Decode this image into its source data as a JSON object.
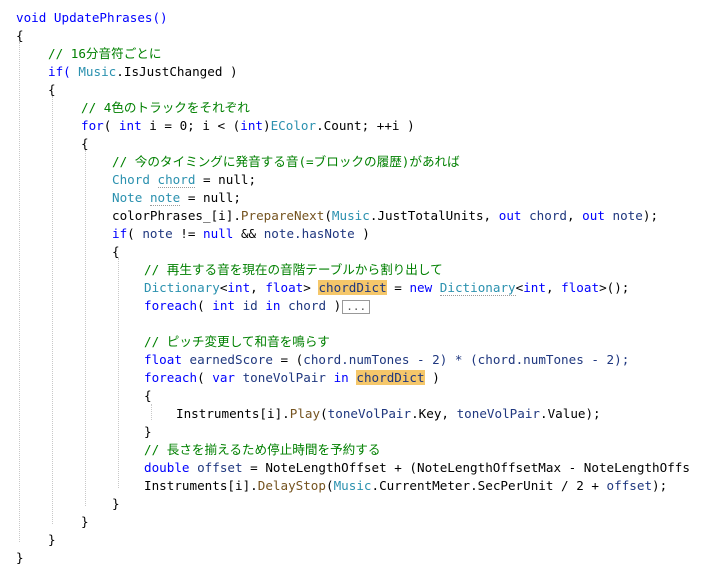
{
  "code": {
    "l01": "void UpdatePhrases()",
    "brace_open": "{",
    "brace_close": "}",
    "comment_16th": "// 16分音符ごとに",
    "if_music": "if( ",
    "music": "Music",
    "dot": ".",
    "is_just_changed": "IsJustChanged",
    "paren_close": " )",
    "comment_4color": "// 4色のトラックをそれぞれ",
    "for_kw": "for",
    "for_open": "( ",
    "int_kw": "int",
    "for_mid1": " i = 0; i < (",
    "for_mid2": ")",
    "ecolor": "EColor",
    "for_end": ".Count; ++i )",
    "comment_timing": "// 今のタイミングに発音する音(=ブロックの履歴)があれば",
    "chord_type": "Chord",
    "chord_var": "chord",
    "eq_null": " = null;",
    "null_kw": "null",
    "note_type": "Note",
    "note_var": "note",
    "color_phrases": "colorPhrases_[i].",
    "prepare_next": "PrepareNext",
    "just_total_units": ".JustTotalUnits, ",
    "out_kw": "out",
    "comma_space": ", ",
    "close_paren_semi": ");",
    "if_kw": "if",
    "neq_null": " != ",
    "and_and": " && ",
    "has_note": "note.hasNote",
    "comment_replay": "// 再生する音を現在の音階テーブルから割り出して",
    "dictionary": "Dictionary",
    "lt": "<",
    "float_kw": "float",
    "gt": ">",
    "chord_dict": "chordDict",
    "eq_new": " = ",
    "new_kw": "new",
    "gt_call": ">();",
    "foreach_kw": "foreach",
    "id_var": " id ",
    "in_kw": "in",
    "fold_ellipsis": "...",
    "comment_pitch": "// ピッチ変更して和音を鳴らす",
    "earned_score": "earnedScore",
    "num_tones_a": "chord.numTones - 2) * (",
    "num_tones_b": "chord.numTones - 2);",
    "var_kw": "var",
    "tone_vol_pair": "toneVolPair",
    "instruments": "Instruments[i].",
    "play": "Play",
    "key_part": ".Key, ",
    "value_part": ".Value);",
    "comment_length": "// 長さを揃えるため停止時間を予約する",
    "double_kw": "double",
    "offset_var": "offset",
    "offset_expr": " = NoteLengthOffset + (NoteLengthOffsetMax - NoteLengthOffs",
    "delay_stop": "DelayStop",
    "current_meter": ".CurrentMeter.SecPerUnit / 2 + ",
    "semi_end": ");"
  }
}
